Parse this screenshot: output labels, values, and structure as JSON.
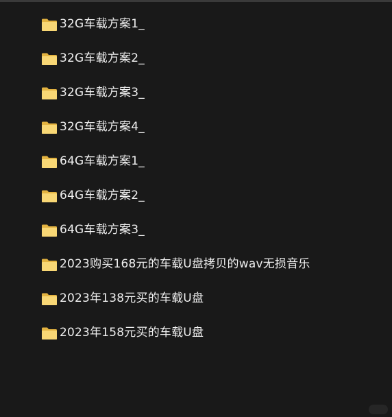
{
  "folders": [
    {
      "name": "32G车载方案1_",
      "icon": "folder-icon"
    },
    {
      "name": "32G车载方案2_",
      "icon": "folder-icon"
    },
    {
      "name": "32G车载方案3_",
      "icon": "folder-icon"
    },
    {
      "name": "32G车载方案4_",
      "icon": "folder-icon"
    },
    {
      "name": "64G车载方案1_",
      "icon": "folder-icon"
    },
    {
      "name": "64G车载方案2_",
      "icon": "folder-icon"
    },
    {
      "name": "64G车载方案3_",
      "icon": "folder-icon"
    },
    {
      "name": "2023购买168元的车载U盘拷贝的wav无损音乐",
      "icon": "folder-icon"
    },
    {
      "name": "2023年138元买的车载U盘",
      "icon": "folder-icon"
    },
    {
      "name": "2023年158元买的车载U盘",
      "icon": "folder-icon"
    }
  ],
  "colors": {
    "background": "#191919",
    "text": "#f0f0f0",
    "folder_fill": "#F8D775",
    "folder_back": "#E3B341"
  }
}
